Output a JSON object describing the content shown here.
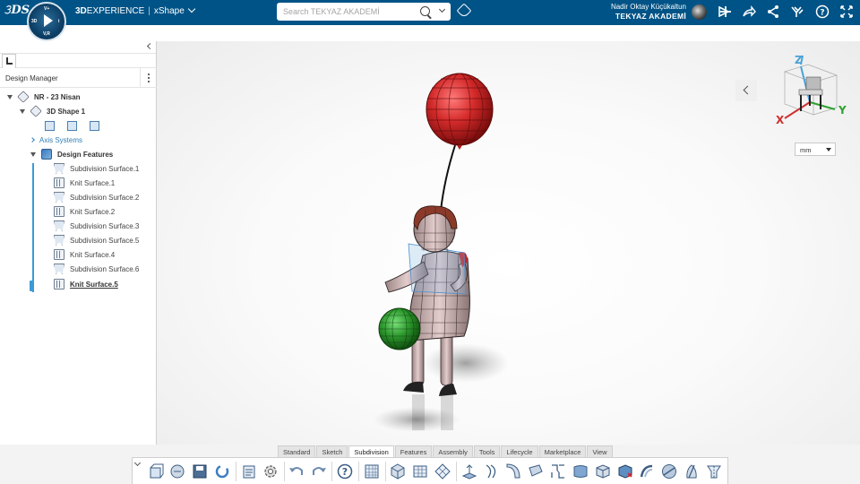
{
  "topbar": {
    "brand_bold": "3D",
    "brand_rest": "EXPERIENCE",
    "app_name": "xShape",
    "search_placeholder": "Search TEKYAZ AKADEMİ",
    "user_name": "Nadir Oktay Küçükaltun",
    "tenant": "TEKYAZ AKADEMİ",
    "compass": {
      "top": "V+",
      "left": "3D",
      "right": "i",
      "bottom": "V,R"
    },
    "icons": [
      "share-icon",
      "add-icon",
      "forward-icon",
      "network-icon",
      "apps-icon",
      "help-icon",
      "fullscreen-icon"
    ]
  },
  "panel": {
    "header": "Design Manager",
    "tree": [
      {
        "label": "NR - 23 Nisan",
        "icon": "product-icon",
        "style": "bold"
      },
      {
        "label": "3D Shape 1",
        "icon": "shape-icon",
        "style": "bold"
      },
      {
        "label": "Axis Systems",
        "icon": "",
        "style": "blue"
      },
      {
        "label": "Design Features",
        "icon": "features-icon",
        "style": "bold"
      },
      {
        "label": "Subdivision Surface.1",
        "icon": "subdivision-icon",
        "style": ""
      },
      {
        "label": "Knit Surface.1",
        "icon": "knit-icon",
        "style": ""
      },
      {
        "label": "Subdivision Surface.2",
        "icon": "subdivision-icon",
        "style": ""
      },
      {
        "label": "Knit Surface.2",
        "icon": "knit-icon",
        "style": ""
      },
      {
        "label": "Subdivision Surface.3",
        "icon": "subdivision-icon",
        "style": ""
      },
      {
        "label": "Subdivision Surface.5",
        "icon": "subdivision-icon",
        "style": ""
      },
      {
        "label": "Knit Surface.4",
        "icon": "knit-icon",
        "style": ""
      },
      {
        "label": "Subdivision Surface.6",
        "icon": "subdivision-icon",
        "style": ""
      },
      {
        "label": "Knit Surface.5",
        "icon": "knit-icon",
        "style": "selected"
      }
    ]
  },
  "viewport": {
    "axes": {
      "z": "Z",
      "y": "Y",
      "x": "X"
    },
    "unit": "mm",
    "colors": {
      "balloon": "#d42a2a",
      "ball": "#2e9a2e",
      "skin": "#d8bcbc",
      "hair": "#8b3a2a"
    }
  },
  "action_bar": {
    "tabs": [
      "Standard",
      "Sketch",
      "Subdivision",
      "Features",
      "Assembly",
      "Tools",
      "Lifecycle",
      "Marketplace",
      "View"
    ],
    "active_tab": "Subdivision"
  }
}
